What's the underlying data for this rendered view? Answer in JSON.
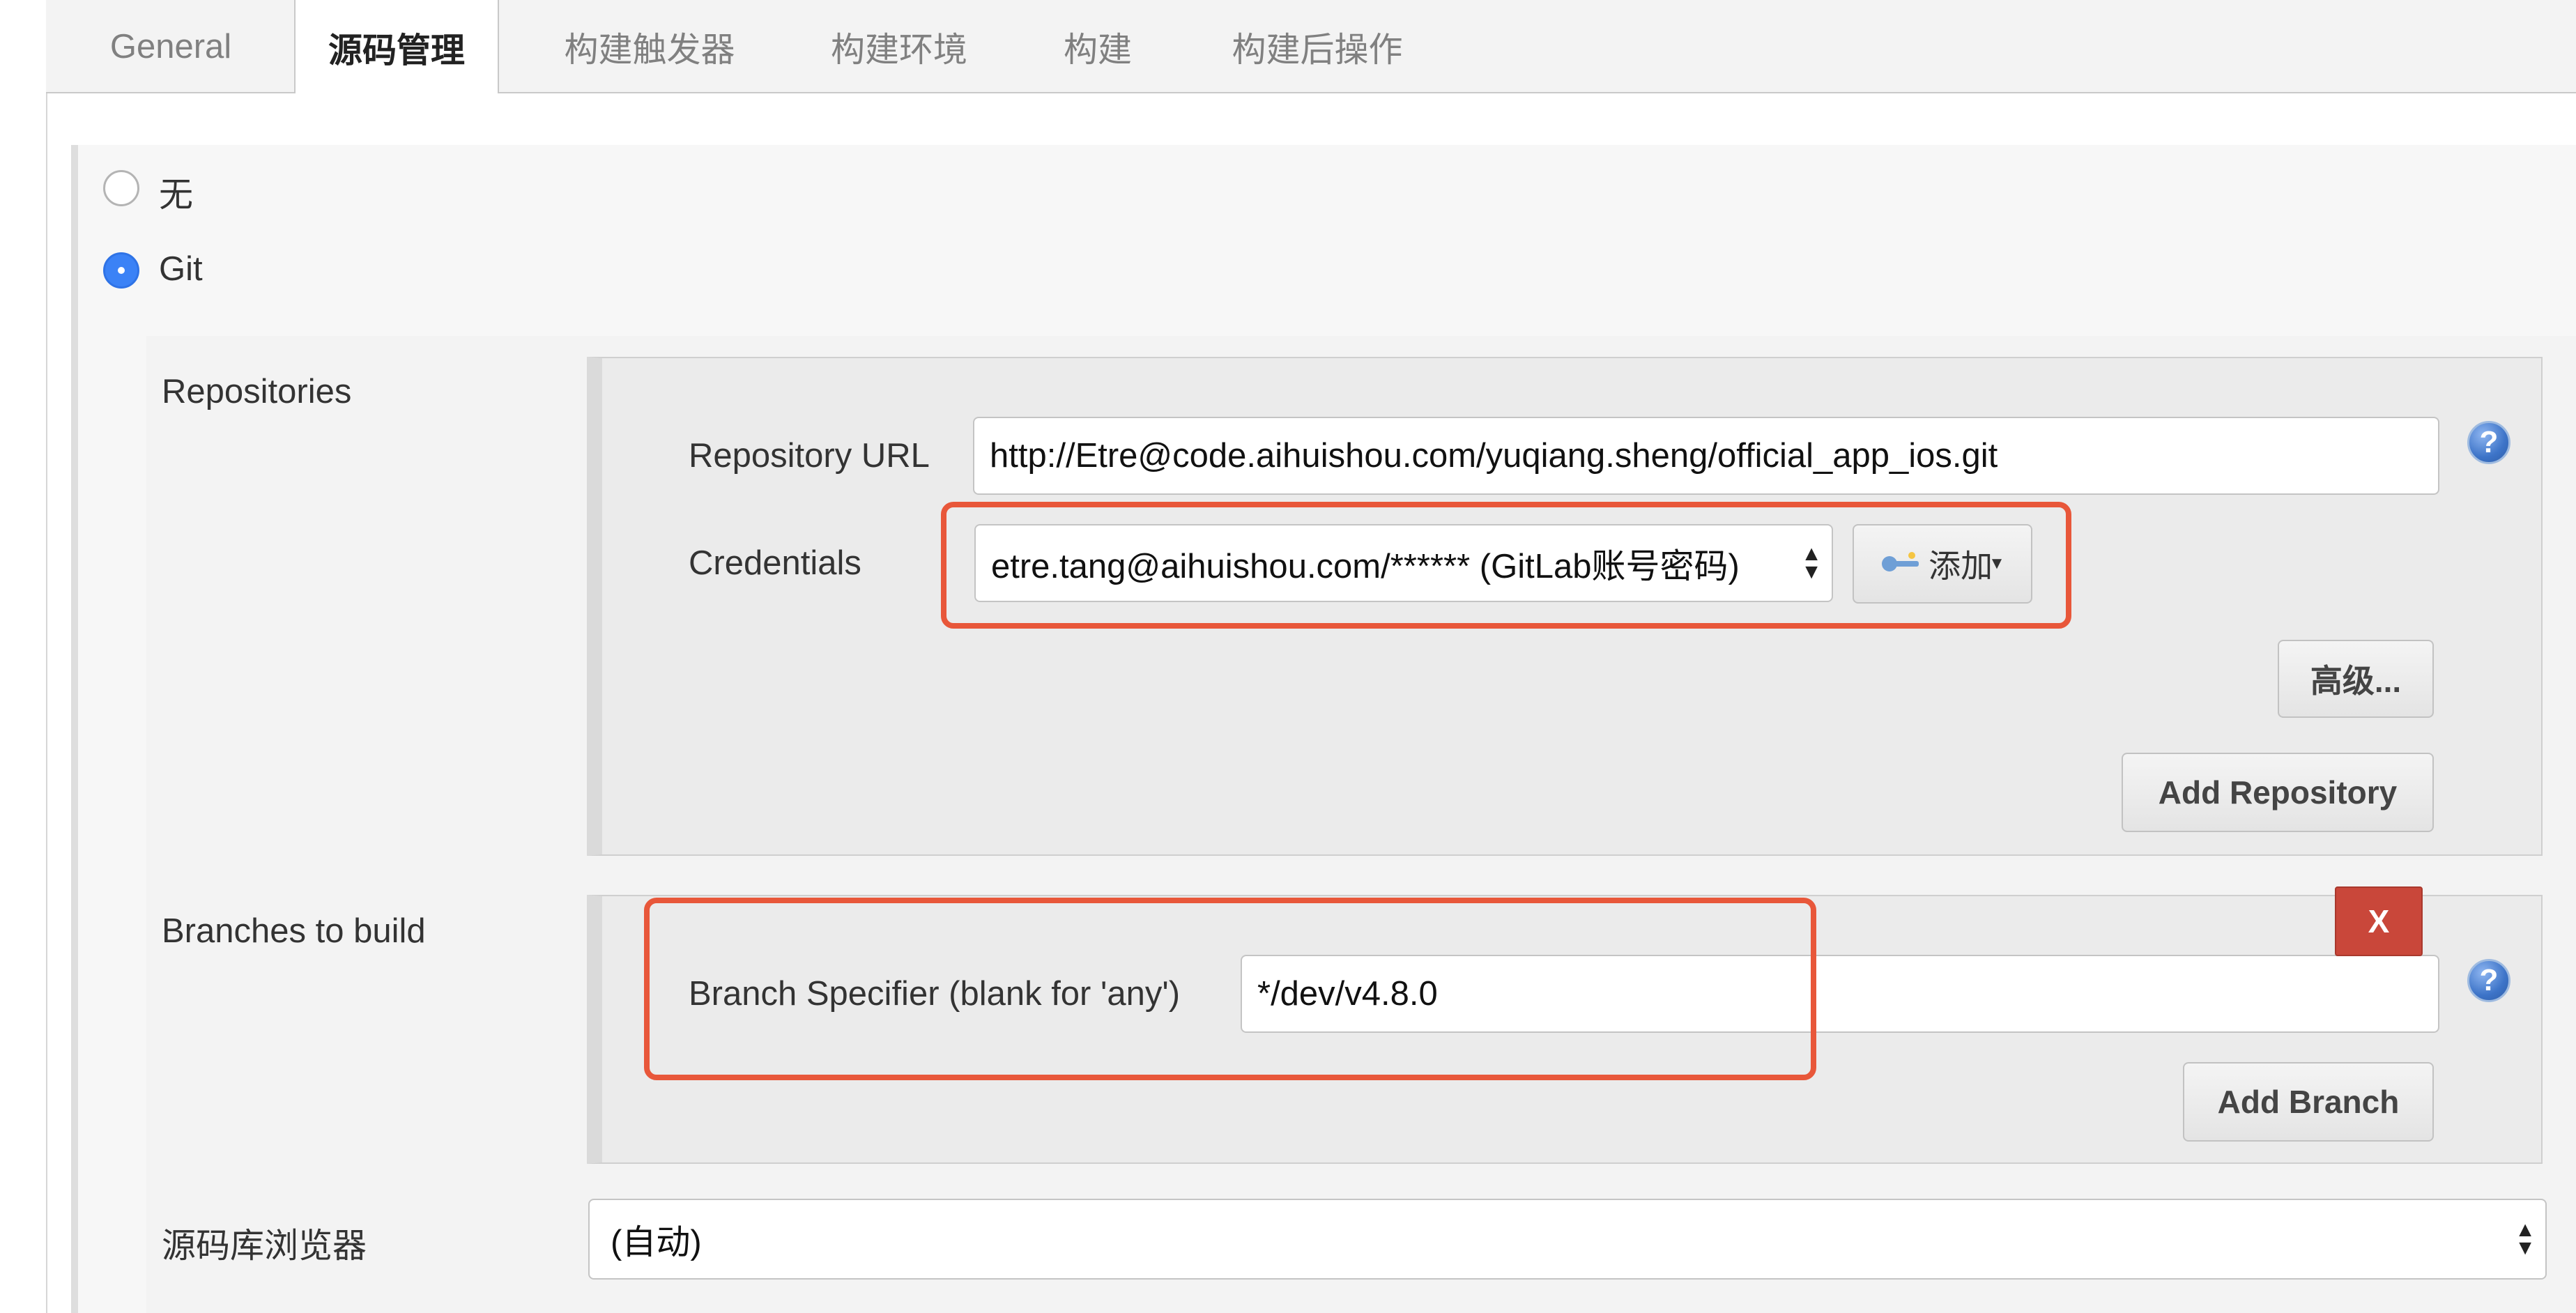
{
  "tabs": [
    {
      "label": "General",
      "active": false
    },
    {
      "label": "源码管理",
      "active": true
    },
    {
      "label": "构建触发器",
      "active": false
    },
    {
      "label": "构建环境",
      "active": false
    },
    {
      "label": "构建",
      "active": false
    },
    {
      "label": "构建后操作",
      "active": false
    }
  ],
  "scm": {
    "options": [
      {
        "label": "无",
        "selected": false
      },
      {
        "label": "Git",
        "selected": true
      }
    ]
  },
  "repositories": {
    "section_label": "Repositories",
    "url_label": "Repository URL",
    "url_value": "http://Etre@code.aihuishou.com/yuqiang.sheng/official_app_ios.git",
    "credentials_label": "Credentials",
    "credentials_value": "etre.tang@aihuishou.com/****** (GitLab账号密码)",
    "add_label": "添加",
    "advanced_label": "高级...",
    "add_repository_label": "Add Repository",
    "help": "?"
  },
  "branches": {
    "section_label": "Branches to build",
    "specifier_label": "Branch Specifier (blank for 'any')",
    "specifier_value": "*/dev/v4.8.0",
    "delete_label": "X",
    "add_branch_label": "Add Branch",
    "help": "?"
  },
  "browser": {
    "label": "源码库浏览器",
    "value": "(自动)"
  },
  "colors": {
    "highlight": "#e8573a",
    "radio_selected": "#3b82f6",
    "delete_button": "#c9473a"
  }
}
